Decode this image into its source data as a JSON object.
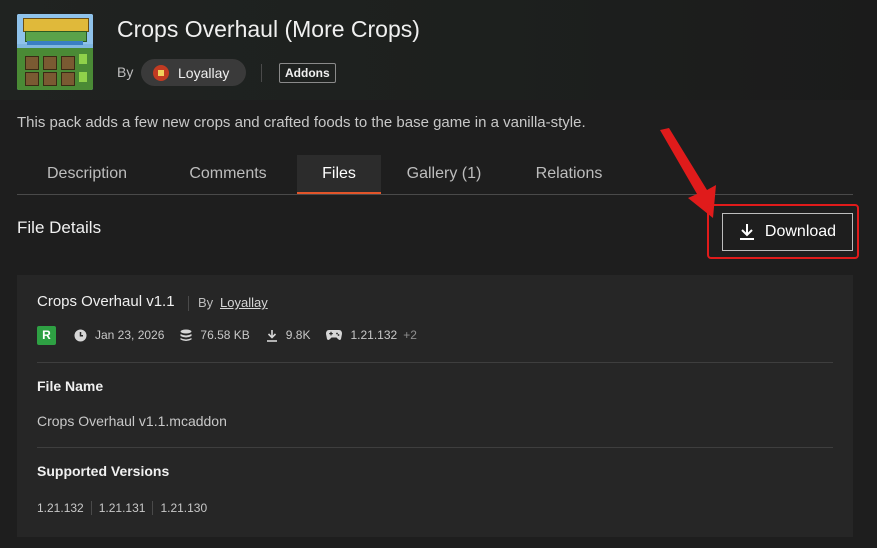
{
  "header": {
    "title": "Crops Overhaul (More Crops)",
    "by_label": "By",
    "author": "Loyallay",
    "tag": "Addons"
  },
  "description": "This pack adds a few new crops and crafted foods to the base game in a vanilla-style.",
  "tabs": [
    {
      "label": "Description"
    },
    {
      "label": "Comments"
    },
    {
      "label": "Files"
    },
    {
      "label": "Gallery (1)"
    },
    {
      "label": "Relations"
    }
  ],
  "active_tab": "Files",
  "section_title": "File Details",
  "download_label": "Download",
  "file": {
    "name_title": "Crops Overhaul v1.1",
    "by_label": "By",
    "author": "Loyallay",
    "release_badge": "R",
    "date": "Jan 23, 2026",
    "size": "76.58 KB",
    "downloads": "9.8K",
    "game_version": "1.21.132",
    "extra_versions": "+2",
    "file_name_label": "File Name",
    "file_name": "Crops Overhaul v1.1.mcaddon",
    "supported_label": "Supported Versions",
    "supported_versions": [
      "1.21.132",
      "1.21.131",
      "1.21.130"
    ]
  },
  "colors": {
    "accent": "#e3552a",
    "release_green": "#2ea043",
    "annotation_red": "#e01b1b"
  },
  "icons": {
    "date": "clock-icon",
    "size": "database-icon",
    "downloads": "download-icon",
    "game_version": "gamepad-icon"
  }
}
